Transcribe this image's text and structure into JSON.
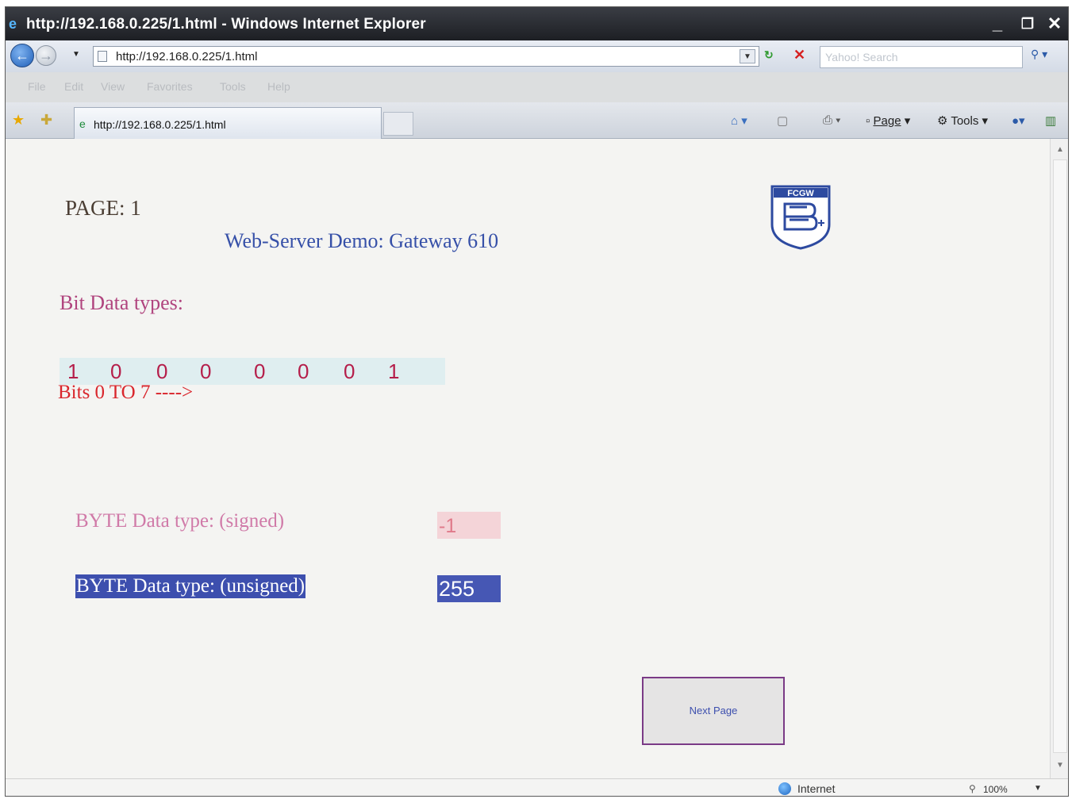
{
  "window": {
    "title": "http://192.168.0.225/1.html - Windows Internet Explorer",
    "minimize": "_",
    "restore": "❐",
    "close": "✕"
  },
  "addressbar": {
    "url": "http://192.168.0.225/1.html",
    "search_placeholder": "Yahoo! Search"
  },
  "menu": {
    "items": [
      "File",
      "Edit",
      "View",
      "Favorites",
      "Tools",
      "Help"
    ]
  },
  "tabs": {
    "active_label": "http://192.168.0.225/1.html"
  },
  "commandbar": {
    "page_label": "Page",
    "tools_label": "Tools"
  },
  "page": {
    "page_label": "PAGE: 1",
    "title": "Web-Server Demo: Gateway 610",
    "logo_text": "FCGW",
    "bit_heading": "Bit Data types:",
    "bits": [
      "1",
      "0",
      "0",
      "0",
      "0",
      "0",
      "0",
      "1"
    ],
    "bits_caption": "Bits 0 TO 7 ---->",
    "byte_signed_label": "BYTE Data type: (signed)",
    "byte_signed_value": "-1",
    "byte_unsigned_label": "BYTE Data type: (unsigned)",
    "byte_unsigned_value": "255",
    "next_button": "Next Page"
  },
  "statusbar": {
    "zone": "Internet",
    "zoom": "100%"
  },
  "colors": {
    "page_title": "#3650a8",
    "bit_heading": "#b0447e",
    "bits": "#b51e4a",
    "bits_caption": "#d9262c",
    "unsigned_bg": "#3d4fae",
    "next_button_border": "#7a3a86"
  }
}
